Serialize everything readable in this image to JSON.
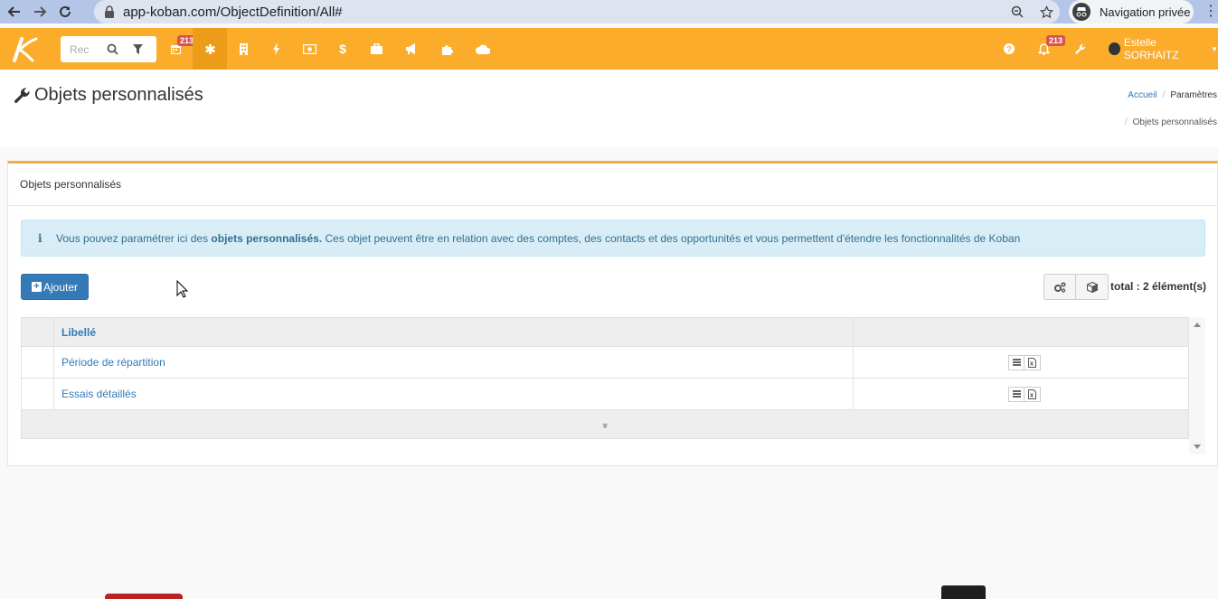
{
  "browser": {
    "url": "app-koban.com/ObjectDefinition/All#",
    "incognito_label": "Navigation privée"
  },
  "appbar": {
    "search_placeholder": "Rec",
    "calendar_badge": "213",
    "notif_badge": "213",
    "user_name": "Estelle SORHAITZ",
    "accent": "#fbac2b"
  },
  "header": {
    "title": "Objets personnalisés",
    "breadcrumb_home": "Accueil",
    "breadcrumb_params": "Paramètres",
    "breadcrumb_current": "Objets personnalisés",
    "breadcrumb_sep": "/"
  },
  "panel": {
    "title": "Objets personnalisés",
    "alert_icon": "i",
    "alert_pre": "Vous pouvez paramétrer ici des ",
    "alert_bold": "objets personnalisés.",
    "alert_post": " Ces objet peuvent être en relation avec des comptes, des contacts et des opportunités et vous permettent d'étendre les fonctionnalités de Koban",
    "add_label": "Ajouter",
    "total_label": "total : 2 élément(s)"
  },
  "table": {
    "col_label": "Libellé",
    "rows": [
      {
        "label": "Période de répartition"
      },
      {
        "label": "Essais détaillés"
      }
    ],
    "expand_glyph": "»"
  }
}
